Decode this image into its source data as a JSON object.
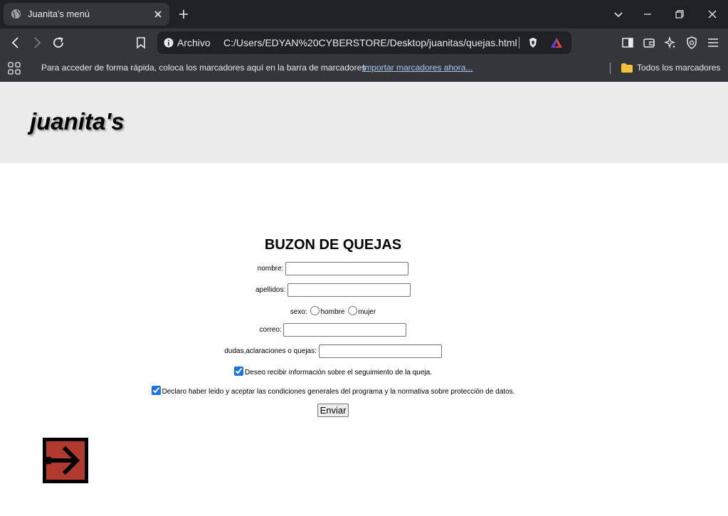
{
  "browser": {
    "tab_title": "Juanita's menú",
    "omnibox_label": "Archivo",
    "url": "C:/Users/EDYAN%20CYBERSTORE/Desktop/juanitas/quejas.html",
    "bookmarks_prompt": "Para acceder de forma rápida, coloca los marcadores aquí en la barra de marcadores",
    "bookmarks_import_link": "Importar marcadores ahora...",
    "all_bookmarks": "Todos los marcadores"
  },
  "page": {
    "brand": "juanita's",
    "form": {
      "title": "BUZON DE QUEJAS",
      "nombre_label": "nombre:",
      "nombre_value": "",
      "apellidos_label": "apellidos:",
      "apellidos_value": "",
      "sexo_label": "sexo:",
      "sexo_options": [
        "hombre",
        "mujer"
      ],
      "correo_label": "correo:",
      "correo_value": "",
      "dudas_label": "dudas,aclaraciones o quejas:",
      "dudas_value": "",
      "checkbox_seguimiento": "Deseo recibir información sobre el seguimiento de la queja.",
      "checkbox_condiciones": "Declaro haber leido y aceptar las condiciones generales del programa y la normativa sobre protección de datos.",
      "submit_label": "Enviar"
    },
    "exit_button_icon": "exit-arrow-icon"
  },
  "colors": {
    "tabstrip": "#202124",
    "toolbar": "#35363a",
    "header_bg": "#ebebeb",
    "exit_button_bg": "#000000",
    "exit_button_fill": "#c0392b"
  }
}
